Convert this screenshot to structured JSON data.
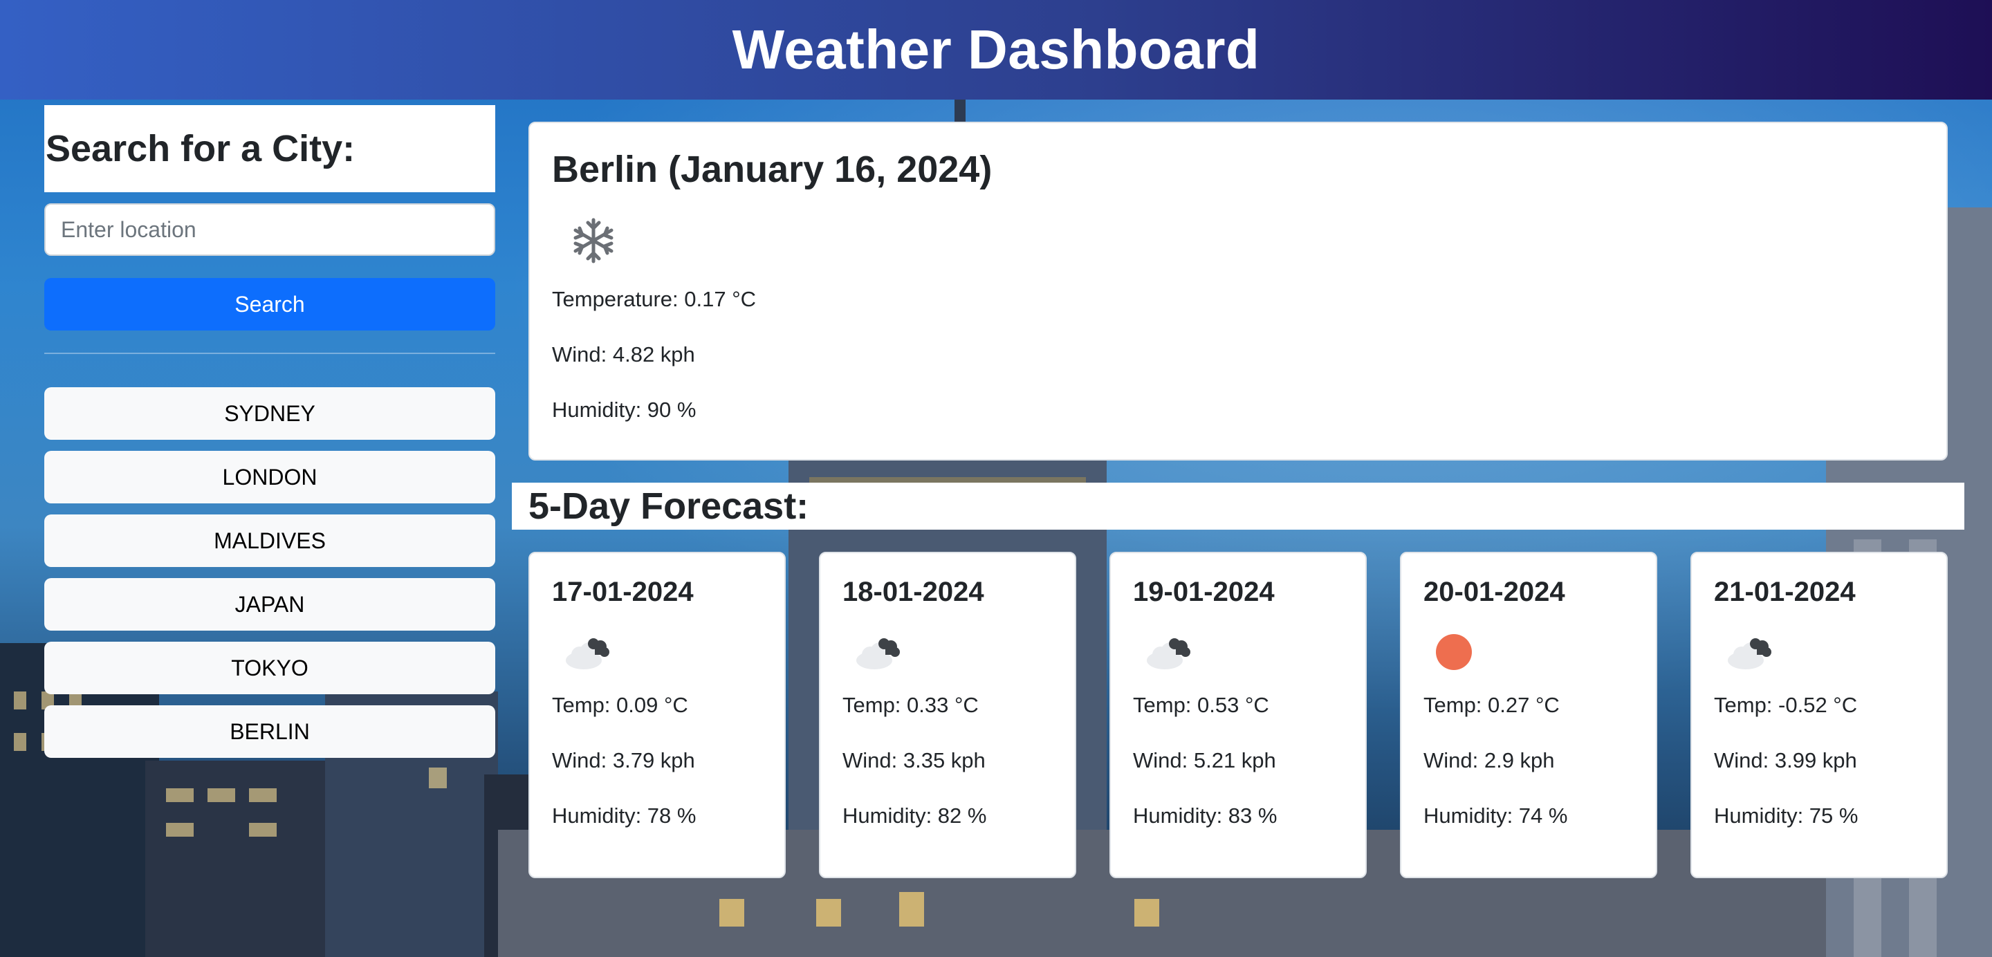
{
  "header": {
    "title": "Weather Dashboard"
  },
  "sidebar": {
    "heading": "Search for a City:",
    "search_placeholder": "Enter location",
    "search_value": "",
    "search_button": "Search",
    "history": [
      "SYDNEY",
      "LONDON",
      "MALDIVES",
      "JAPAN",
      "TOKYO",
      "BERLIN"
    ]
  },
  "current": {
    "title": "Berlin (January 16, 2024)",
    "icon": "snow-icon",
    "temperature": "Temperature: 0.17 °C",
    "wind": "Wind: 4.82 kph",
    "humidity": "Humidity: 90 %"
  },
  "forecast": {
    "heading": "5-Day Forecast:",
    "days": [
      {
        "date": "17-01-2024",
        "icon": "cloudy-icon",
        "temp": "Temp: 0.09 °C",
        "wind": "Wind: 3.79 kph",
        "humidity": "Humidity: 78 %"
      },
      {
        "date": "18-01-2024",
        "icon": "cloudy-icon",
        "temp": "Temp: 0.33 °C",
        "wind": "Wind: 3.35 kph",
        "humidity": "Humidity: 82 %"
      },
      {
        "date": "19-01-2024",
        "icon": "cloudy-icon",
        "temp": "Temp: 0.53 °C",
        "wind": "Wind: 5.21 kph",
        "humidity": "Humidity: 83 %"
      },
      {
        "date": "20-01-2024",
        "icon": "sun-icon",
        "temp": "Temp: 0.27 °C",
        "wind": "Wind: 2.9 kph",
        "humidity": "Humidity: 74 %"
      },
      {
        "date": "21-01-2024",
        "icon": "cloudy-icon",
        "temp": "Temp: -0.52 °C",
        "wind": "Wind: 3.99 kph",
        "humidity": "Humidity: 75 %"
      }
    ]
  },
  "colors": {
    "header_start": "#3460c4",
    "header_end": "#1e0f55",
    "search_button": "#0d6efd",
    "history_button": "#f8f9fa",
    "sun": "#ee6e4f"
  }
}
